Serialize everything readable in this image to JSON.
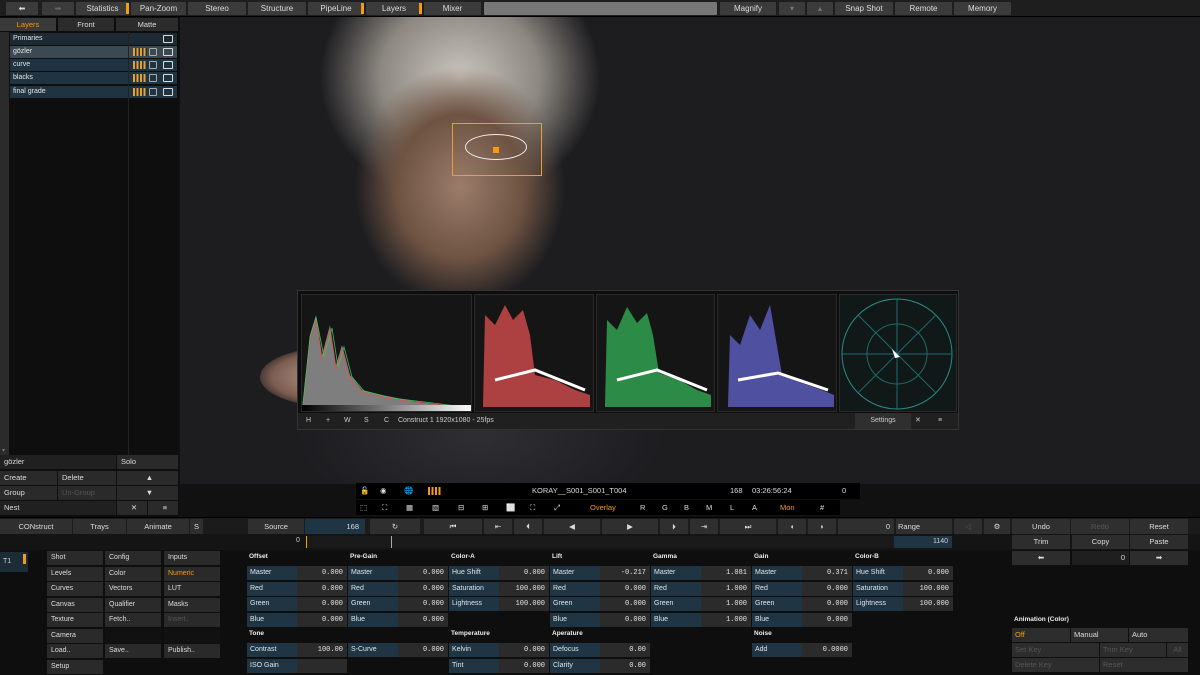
{
  "topbar": {
    "items": [
      "Statistics",
      "Pan-Zoom",
      "Stereo",
      "Structure",
      "PipeLine",
      "Layers",
      "Mixer",
      "Magnify",
      "Snap Shot",
      "Remote",
      "Memory"
    ]
  },
  "left": {
    "tabs": [
      "Layers",
      "Front",
      "Matte"
    ],
    "group": "Primaries",
    "layers": [
      "gözler",
      "curve",
      "blacks",
      "final grade"
    ],
    "selected_name": "gözler",
    "solo": "Solo",
    "create": "Create",
    "delete": "Delete",
    "group_btn": "Group",
    "ungroup": "Un-Group",
    "nest": "Nest"
  },
  "viewer": {
    "scope_h": "H",
    "scope_w": "W",
    "scope_s": "S",
    "scope_c": "C",
    "plus": "+",
    "format": "Construct 1 1920x1080 - 25fps",
    "settings": "Settings",
    "clip": "KORAY__S001_S001_T004",
    "frame": "168",
    "tc": "03:26:56:24",
    "zero": "0",
    "overlay": "Overlay",
    "rgbm": [
      "R",
      "G",
      "B",
      "M",
      "L",
      "A"
    ],
    "mon": "Mon"
  },
  "transport": {
    "construct": "CONstruct",
    "trays": "Trays",
    "animate": "Animate",
    "s": "S",
    "source": "Source",
    "frame": "168",
    "frame_out": "0",
    "range": "Range",
    "undo": "Undo",
    "redo": "Redo",
    "reset": "Reset",
    "tl_start": "0",
    "tl_end": "1140"
  },
  "track": {
    "t1": "T1"
  },
  "menu": {
    "col1": [
      "Shot",
      "Levels",
      "Curves",
      "Canvas",
      "Texture",
      "Camera",
      "Load..",
      "Setup"
    ],
    "col2": [
      "Config",
      "Color",
      "Vectors",
      "Qualifier",
      "Fetch..",
      "",
      "Save.."
    ],
    "col3": [
      "Inputs",
      "Numeric",
      "LUT",
      "Masks",
      "Insert..",
      "",
      "Publish.."
    ]
  },
  "params": {
    "offset": {
      "title": "Offset",
      "rows": [
        [
          "Master",
          "0.000"
        ],
        [
          "Red",
          "0.000"
        ],
        [
          "Green",
          "0.000"
        ],
        [
          "Blue",
          "0.000"
        ]
      ]
    },
    "pregain": {
      "title": "Pre-Gain",
      "rows": [
        [
          "Master",
          "0.000"
        ],
        [
          "Red",
          "0.000"
        ],
        [
          "Green",
          "0.000"
        ],
        [
          "Blue",
          "0.000"
        ]
      ]
    },
    "colora": {
      "title": "Color-A",
      "rows": [
        [
          "Hue Shift",
          "0.000"
        ],
        [
          "Saturation",
          "100.000"
        ],
        [
          "Lightness",
          "100.000"
        ]
      ]
    },
    "lift": {
      "title": "Lift",
      "rows": [
        [
          "Master",
          "-0.217"
        ],
        [
          "Red",
          "0.000"
        ],
        [
          "Green",
          "0.000"
        ],
        [
          "Blue",
          "0.000"
        ]
      ]
    },
    "gamma": {
      "title": "Gamma",
      "rows": [
        [
          "Master",
          "1.081"
        ],
        [
          "Red",
          "1.000"
        ],
        [
          "Green",
          "1.000"
        ],
        [
          "Blue",
          "1.000"
        ]
      ]
    },
    "gain": {
      "title": "Gain",
      "rows": [
        [
          "Master",
          "0.371"
        ],
        [
          "Red",
          "0.000"
        ],
        [
          "Green",
          "0.000"
        ],
        [
          "Blue",
          "0.000"
        ]
      ]
    },
    "colorb": {
      "title": "Color-B",
      "rows": [
        [
          "Hue Shift",
          "0.000"
        ],
        [
          "Saturation",
          "100.000"
        ],
        [
          "Lightness",
          "100.000"
        ]
      ]
    },
    "tone": {
      "title": "Tone",
      "rows": [
        [
          "Contrast",
          "100.00"
        ],
        [
          "ISO Gain",
          ""
        ]
      ],
      "scurve": [
        "S-Curve",
        "0.000"
      ]
    },
    "temperature": {
      "title": "Temperature",
      "rows": [
        [
          "Kelvin",
          "0.000"
        ],
        [
          "Tint",
          "0.000"
        ]
      ]
    },
    "aperture": {
      "title": "Aperature",
      "rows": [
        [
          "Defocus",
          "0.00"
        ],
        [
          "Clarity",
          "0.00"
        ]
      ]
    },
    "noise": {
      "title": "Noise",
      "rows": [
        [
          "Add",
          "0.0000"
        ]
      ]
    }
  },
  "right": {
    "trim": "Trim",
    "copy": "Copy",
    "paste": "Paste",
    "step_val": "0",
    "anim_title": "Animation (Color)",
    "off": "Off",
    "manual": "Manual",
    "auto": "Auto",
    "setkey": "Set Key",
    "trimkey": "Trim Key",
    "all": "All",
    "deletekey": "Delete Key",
    "reset": "Reset"
  },
  "colors": {
    "accent": "#f39c12",
    "layer_bg": "#1f3340",
    "param_bg": "#1f3544"
  }
}
